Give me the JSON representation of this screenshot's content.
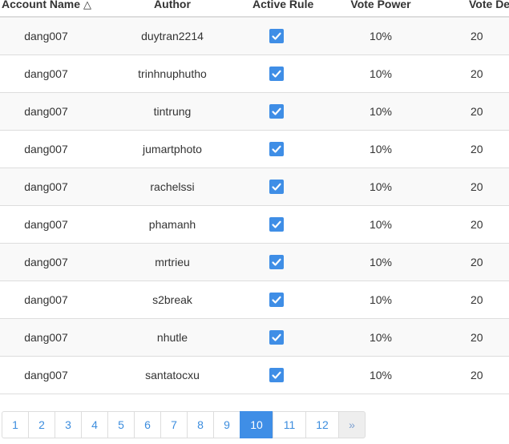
{
  "table": {
    "columns": [
      {
        "label": "Account Name",
        "sort_indicator": "△"
      },
      {
        "label": "Author"
      },
      {
        "label": "Active Rule"
      },
      {
        "label": "Vote Power"
      },
      {
        "label": "Vote Delay"
      }
    ],
    "rows": [
      {
        "account": "dang007",
        "author": "duytran2214",
        "active": true,
        "vote_power": "10%",
        "vote_delay": "20"
      },
      {
        "account": "dang007",
        "author": "trinhnuphutho",
        "active": true,
        "vote_power": "10%",
        "vote_delay": "20"
      },
      {
        "account": "dang007",
        "author": "tintrung",
        "active": true,
        "vote_power": "10%",
        "vote_delay": "20"
      },
      {
        "account": "dang007",
        "author": "jumartphoto",
        "active": true,
        "vote_power": "10%",
        "vote_delay": "20"
      },
      {
        "account": "dang007",
        "author": "rachelssi",
        "active": true,
        "vote_power": "10%",
        "vote_delay": "20"
      },
      {
        "account": "dang007",
        "author": "phamanh",
        "active": true,
        "vote_power": "10%",
        "vote_delay": "20"
      },
      {
        "account": "dang007",
        "author": "mrtrieu",
        "active": true,
        "vote_power": "10%",
        "vote_delay": "20"
      },
      {
        "account": "dang007",
        "author": "s2break",
        "active": true,
        "vote_power": "10%",
        "vote_delay": "20"
      },
      {
        "account": "dang007",
        "author": "nhutle",
        "active": true,
        "vote_power": "10%",
        "vote_delay": "20"
      },
      {
        "account": "dang007",
        "author": "santatocxu",
        "active": true,
        "vote_power": "10%",
        "vote_delay": "20"
      }
    ]
  },
  "pagination": {
    "pages": [
      "1",
      "2",
      "3",
      "4",
      "5",
      "6",
      "7",
      "8",
      "9",
      "10",
      "11",
      "12"
    ],
    "current": "10",
    "next_label": "»"
  },
  "colors": {
    "accent": "#3f8ee6",
    "link": "#3c8dde",
    "row_stripe": "#f9f9f9",
    "border": "#dddddd"
  }
}
